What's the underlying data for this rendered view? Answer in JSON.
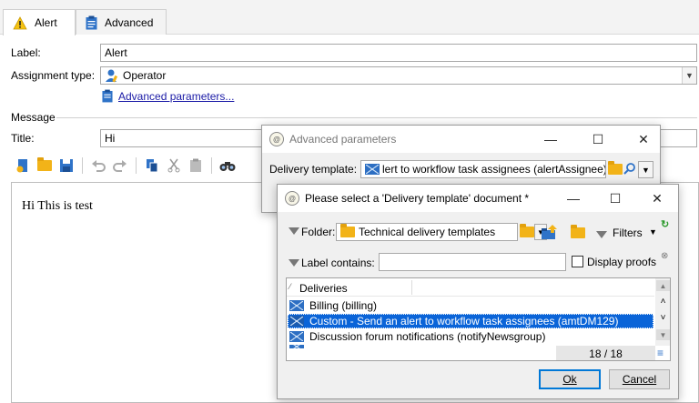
{
  "tabs": [
    {
      "label": "Alert",
      "icon": "warning-icon"
    },
    {
      "label": "Advanced",
      "icon": "clipboard-icon"
    }
  ],
  "form": {
    "label_label": "Label:",
    "label_value": "Alert",
    "assignment_label": "Assignment type:",
    "assignment_value": "Operator",
    "advanced_link": "Advanced parameters...",
    "message_section": "Message",
    "title_label": "Title:",
    "title_value": "Hi",
    "body_text": "Hi This is test"
  },
  "adv_dialog": {
    "title": "Advanced parameters",
    "delivery_label": "Delivery template:",
    "delivery_value": "lert to workflow task assignees (alertAssignee)"
  },
  "select_dialog": {
    "title": "Please select a 'Delivery template' document *",
    "folder_label": "Folder:",
    "folder_value": "Technical delivery templates",
    "filters_label": "Filters",
    "label_contains": "Label contains:",
    "label_contains_value": "",
    "display_proofs": "Display proofs",
    "column_header": "Deliveries",
    "rows": [
      "Billing (billing)",
      "Custom - Send an alert to workflow task assignees (amtDM129)",
      "Discussion forum notifications (notifyNewsgroup)"
    ],
    "selected_index": 1,
    "count": "18 / 18",
    "ok": "Ok",
    "cancel": "Cancel"
  },
  "colors": {
    "selection": "#0a64d8",
    "link": "#1a1aa6",
    "accent": "#0078d7"
  }
}
